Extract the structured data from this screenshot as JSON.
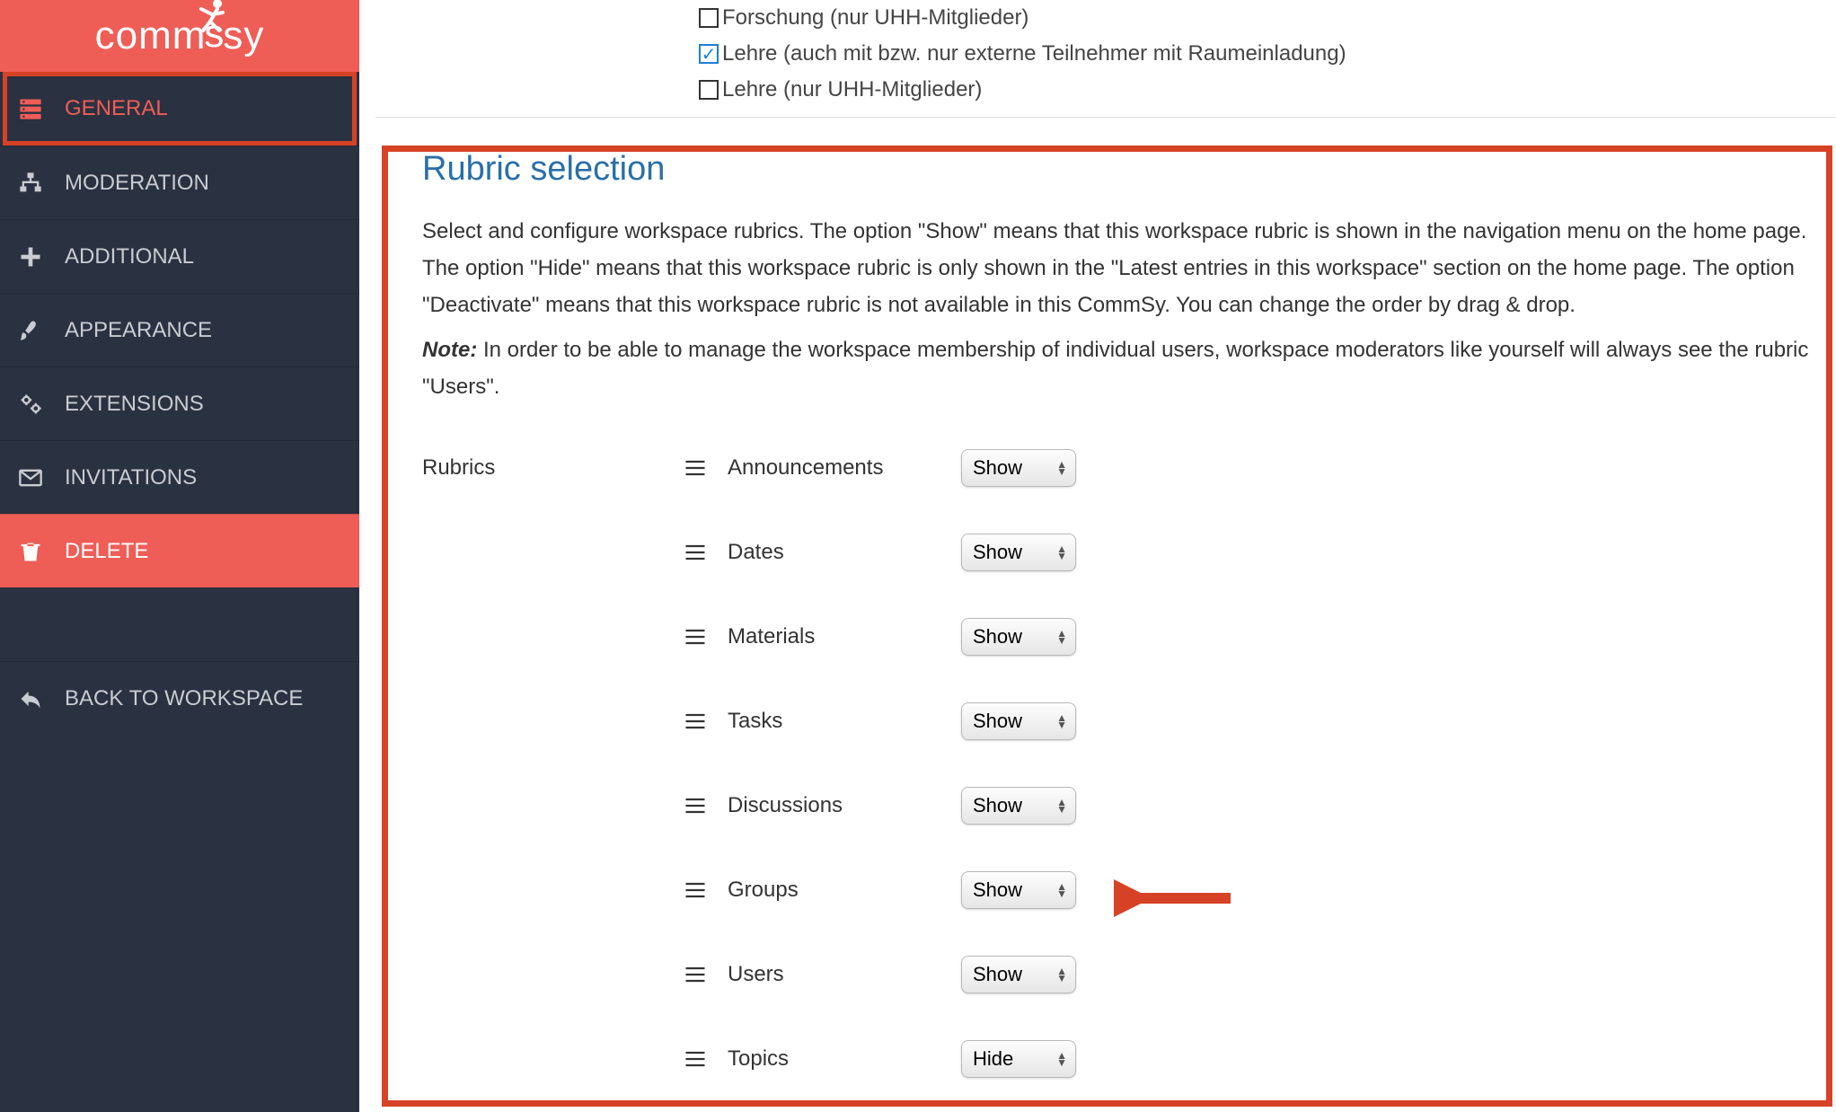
{
  "logo": {
    "text": "commsy"
  },
  "sidebar": {
    "items": [
      {
        "label": "GENERAL",
        "icon": "server-icon",
        "active": true
      },
      {
        "label": "MODERATION",
        "icon": "sitemap-icon",
        "active": false
      },
      {
        "label": "ADDITIONAL",
        "icon": "plus-icon",
        "active": false
      },
      {
        "label": "APPEARANCE",
        "icon": "brush-icon",
        "active": false
      },
      {
        "label": "EXTENSIONS",
        "icon": "gears-icon",
        "active": false
      },
      {
        "label": "INVITATIONS",
        "icon": "envelope-icon",
        "active": false
      },
      {
        "label": "DELETE",
        "icon": "trash-icon",
        "active": false,
        "danger": true
      }
    ],
    "back": {
      "label": "BACK TO WORKSPACE",
      "icon": "reply-icon"
    }
  },
  "checkboxes": [
    {
      "label": "Forschung (nur UHH-Mitglieder)",
      "checked": false
    },
    {
      "label": "Lehre (auch mit bzw. nur externe Teilnehmer mit Raumeinladung)",
      "checked": true
    },
    {
      "label": "Lehre (nur UHH-Mitglieder)",
      "checked": false
    }
  ],
  "section": {
    "title": "Rubric selection",
    "paragraph": "Select and configure workspace rubrics. The option \"Show\" means that this workspace rubric is shown in the navigation menu on the home page. The option \"Hide\" means that this workspace rubric is only shown in the \"Latest entries in this workspace\" section on the home page. The option \"Deactivate\" means that this workspace rubric is not available in this CommSy. You can change the order by drag & drop.",
    "note_label": "Note:",
    "note_text": " In order to be able to manage the workspace membership of individual users, workspace moderators like yourself will always see the rubric \"Users\"."
  },
  "rubrics": {
    "heading": "Rubrics",
    "options": [
      "Show",
      "Hide",
      "Deactivate"
    ],
    "rows": [
      {
        "name": "Announcements",
        "value": "Show"
      },
      {
        "name": "Dates",
        "value": "Show"
      },
      {
        "name": "Materials",
        "value": "Show"
      },
      {
        "name": "Tasks",
        "value": "Show"
      },
      {
        "name": "Discussions",
        "value": "Show"
      },
      {
        "name": "Groups",
        "value": "Show"
      },
      {
        "name": "Users",
        "value": "Show"
      },
      {
        "name": "Topics",
        "value": "Hide"
      }
    ]
  }
}
